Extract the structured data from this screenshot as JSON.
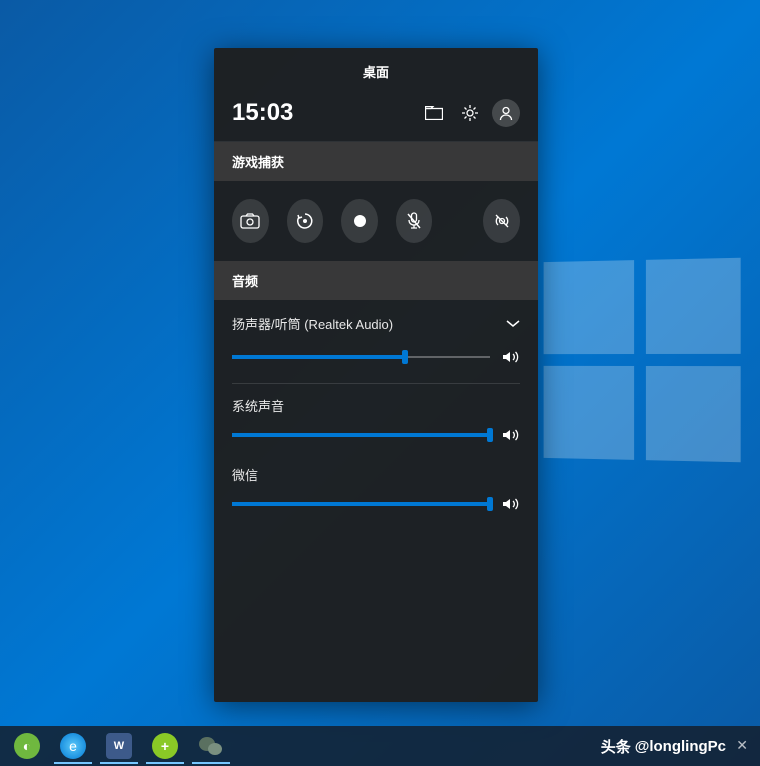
{
  "gamebar": {
    "title": "桌面",
    "time": "15:03",
    "icons": {
      "folder": "folder-icon",
      "settings": "gear-icon",
      "user": "user-icon"
    },
    "capture": {
      "title": "游戏捕获",
      "buttons": [
        "screenshot",
        "record-last",
        "record",
        "mic-off",
        "broadcast"
      ]
    },
    "audio": {
      "title": "音频",
      "device": "扬声器/听筒 (Realtek Audio)",
      "device_volume": 67,
      "mixers": [
        {
          "label": "系统声音",
          "volume": 100
        },
        {
          "label": "微信",
          "volume": 100
        }
      ]
    }
  },
  "taskbar": {
    "items": [
      {
        "name": "app1",
        "color": "#6fb83f"
      },
      {
        "name": "edge",
        "color": "#0078d4"
      },
      {
        "name": "wps",
        "color": "#3d5a8a"
      },
      {
        "name": "app-plus",
        "color": "#8ac926"
      },
      {
        "name": "wechat",
        "color": "#4a5e54"
      }
    ]
  },
  "watermark": {
    "prefix": "头条",
    "handle": "@longlingPc"
  }
}
